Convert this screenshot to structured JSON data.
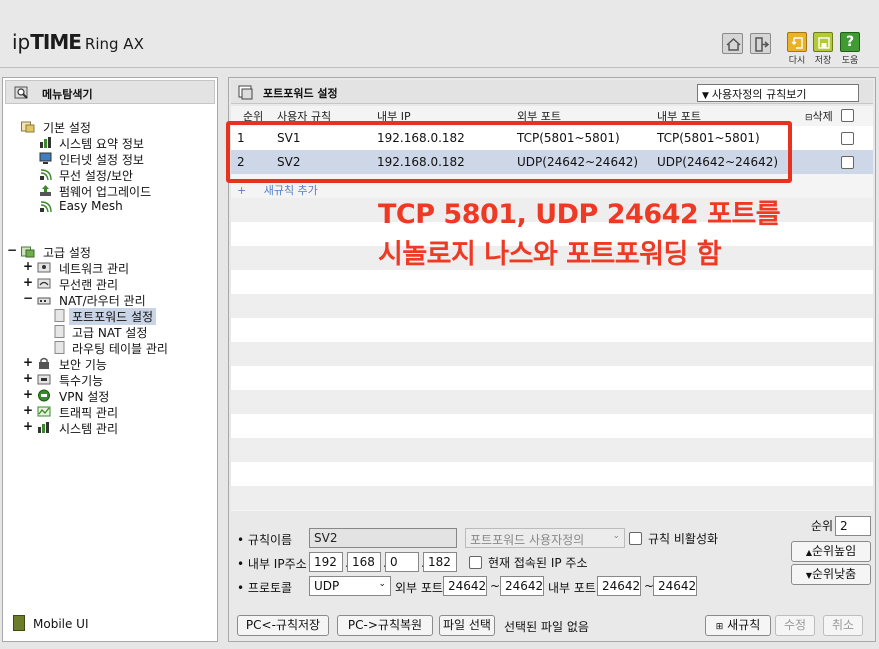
{
  "header": {
    "logo_ip": "ip",
    "logo_time": "TIME",
    "logo_model": "Ring AX",
    "buttons": [
      {
        "label": "다시",
        "color": "#e9b325"
      },
      {
        "label": "저장",
        "color": "#b3c935"
      },
      {
        "label": "도움",
        "color": "#3f9b32"
      }
    ]
  },
  "sidebar": {
    "title": "메뉴탐색기",
    "basic": {
      "label": "기본 설정",
      "items": [
        "시스템 요약 정보",
        "인터넷 설정 정보",
        "무선 설정/보안",
        "펌웨어 업그레이드",
        "Easy Mesh"
      ]
    },
    "advanced": {
      "label": "고급 설정",
      "items": [
        {
          "toggle": "+",
          "label": "네트워크 관리"
        },
        {
          "toggle": "+",
          "label": "무선랜 관리"
        },
        {
          "toggle": "−",
          "label": "NAT/라우터 관리"
        },
        {
          "toggle": "+",
          "label": "보안 기능"
        },
        {
          "toggle": "+",
          "label": "특수기능"
        },
        {
          "toggle": "+",
          "label": "VPN 설정"
        },
        {
          "toggle": "+",
          "label": "트래픽 관리"
        },
        {
          "toggle": "+",
          "label": "시스템 관리"
        }
      ],
      "nat_children": [
        "포트포워드 설정",
        "고급 NAT 설정",
        "라우팅 테이블 관리"
      ],
      "toggle_symbol": "−"
    },
    "mobile_label": "Mobile UI"
  },
  "main": {
    "title": "포트포워드 설정",
    "view_select": "사용자정의 규칙보기",
    "columns": [
      "순위",
      "사용자 규칙",
      "내부 IP",
      "외부 포트",
      "내부 포트",
      "삭제"
    ],
    "rows": [
      {
        "rank": "1",
        "name": "SV1",
        "ip": "192.168.0.182",
        "ext": "TCP(5801~5801)",
        "int": "TCP(5801~5801)"
      },
      {
        "rank": "2",
        "name": "SV2",
        "ip": "192.168.0.182",
        "ext": "UDP(24642~24642)",
        "int": "UDP(24642~24642)"
      }
    ],
    "add_rule": "새규칙 추가",
    "annotation_line1": "TCP 5801, UDP 24642 포트를",
    "annotation_line2": "시놀로지 나스와 포트포워딩 함",
    "annotation_color": "#ee3a24"
  },
  "form": {
    "rule_name_label": "규칙이름",
    "rule_name_value": "SV2",
    "preset_select": "포트포워드 사용자정의",
    "disable_rule_label": "규칙 비활성화",
    "ip_label": "내부 IP주소",
    "ip": [
      "192",
      "168",
      "0",
      "182"
    ],
    "current_ip_label": "현재 접속된 IP 주소",
    "protocol_label": "프로토콜",
    "protocol_value": "UDP",
    "ext_port_label": "외부 포트",
    "ext_port_from": "24642",
    "ext_port_to": "24642",
    "int_port_label": "내부 포트",
    "int_port_from": "24642",
    "int_port_to": "24642",
    "tilde": "~",
    "rank_label": "순위",
    "rank_value": "2",
    "rank_up": "순위높임",
    "rank_down": "순위낮춤"
  },
  "buttons": {
    "pc_save": "PC<-규칙저장",
    "pc_restore": "PC->규칙복원",
    "file_select": "파일 선택",
    "file_status": "선택된 파일 없음",
    "new_rule": "새규칙",
    "modify": "수정",
    "cancel": "취소"
  }
}
